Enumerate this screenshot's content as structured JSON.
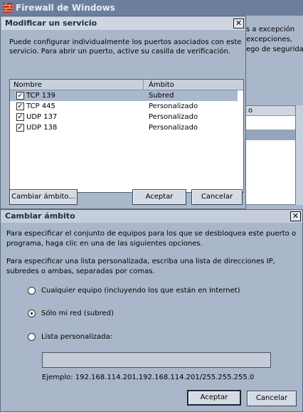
{
  "bg_window": {
    "title": "Firewall de Windows",
    "text_lines": [
      "s a excepción",
      "excepciones,",
      "ego de seguridad"
    ],
    "list_header": "o"
  },
  "dlg1": {
    "title": "Modificar un servicio",
    "close": "✕",
    "description": "Puede configurar individualmente los puertos asociados con este servicio. Para abrir un puerto, active su casilla de verificación.",
    "columns": [
      "Nombre",
      "Ámbito"
    ],
    "rows": [
      {
        "name": "TCP 139",
        "scope": "Subred",
        "checked": true,
        "selected": true
      },
      {
        "name": "TCP 445",
        "scope": "Personalizado",
        "checked": true,
        "selected": false
      },
      {
        "name": "UDP 137",
        "scope": "Personalizado",
        "checked": true,
        "selected": false
      },
      {
        "name": "UDP 138",
        "scope": "Personalizado",
        "checked": true,
        "selected": false
      }
    ],
    "buttons": {
      "change_scope": "Cambiar ámbito...",
      "accept": "Aceptar",
      "cancel": "Cancelar"
    }
  },
  "dlg2": {
    "title": "Cambiar ámbito",
    "close": "✕",
    "para1": "Para especificar el conjunto de equipos para los que se desbloquea este puerto o programa, haga clic en una de las siguientes opciones.",
    "para2": "Para especificar una lista personalizada, escriba una lista de direcciones IP, subredes o ambas, separadas por comas.",
    "options": [
      {
        "label": "Cualquier equipo (incluyendo los que están en Internet)",
        "selected": false
      },
      {
        "label": "Sólo mi red (subred)",
        "selected": true
      },
      {
        "label": "Lista personalizada:",
        "selected": false
      }
    ],
    "custom_value": "",
    "example": "Ejemplo: 192.168.114.201,192.168.114.201/255.255.255.0",
    "buttons": {
      "accept": "Aceptar",
      "cancel": "Cancelar"
    }
  },
  "colors": {
    "title_bg": "#6b7f9c",
    "dialog_bg": "#aab7ca",
    "selection": "#aab8cc"
  }
}
